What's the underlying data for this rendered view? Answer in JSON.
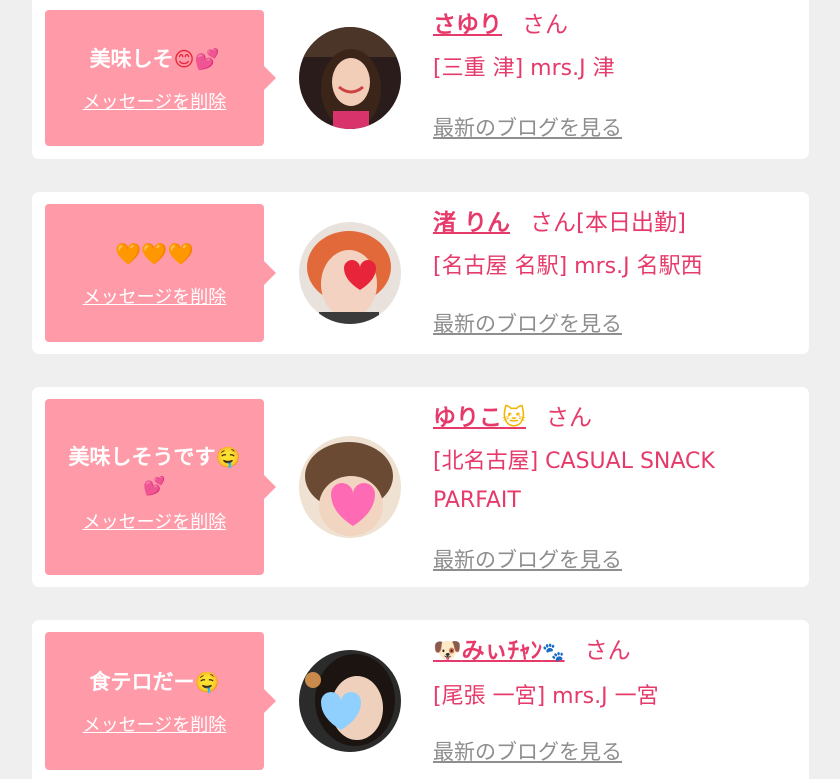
{
  "entries": [
    {
      "message": "美味しそ",
      "message_emoji": "😊💕",
      "delete_label": "メッセージを削除",
      "name": "さゆり",
      "name_emoji": "",
      "name_prefix_emoji": "",
      "honorific": "さん",
      "shop": "[三重 津] mrs.J 津",
      "blog_label": "最新のブログを見る"
    },
    {
      "message": "🧡🧡🧡",
      "message_emoji": "",
      "delete_label": "メッセージを削除",
      "name": "渚 りん",
      "name_emoji": "",
      "name_prefix_emoji": "",
      "honorific": "さん[本日出勤]",
      "shop": "[名古屋 名駅] mrs.J 名駅西",
      "blog_label": "最新のブログを見る"
    },
    {
      "message": "美味しそうです",
      "message_emoji": "🤤",
      "message_line2": "💕",
      "delete_label": "メッセージを削除",
      "name": "ゆりこ",
      "name_emoji": "🐱",
      "name_prefix_emoji": "",
      "honorific": "さん",
      "shop": "[北名古屋] CASUAL SNACK PARFAIT",
      "blog_label": "最新のブログを見る"
    },
    {
      "message": "食テロだー",
      "message_emoji": "🤤",
      "delete_label": "メッセージを削除",
      "name": "みぃﾁｬﾝ",
      "name_emoji": "🐾",
      "name_prefix_emoji": "🐶",
      "honorific": "さん",
      "shop": "[尾張 一宮] mrs.J 一宮",
      "blog_label": "最新のブログを見る"
    }
  ]
}
